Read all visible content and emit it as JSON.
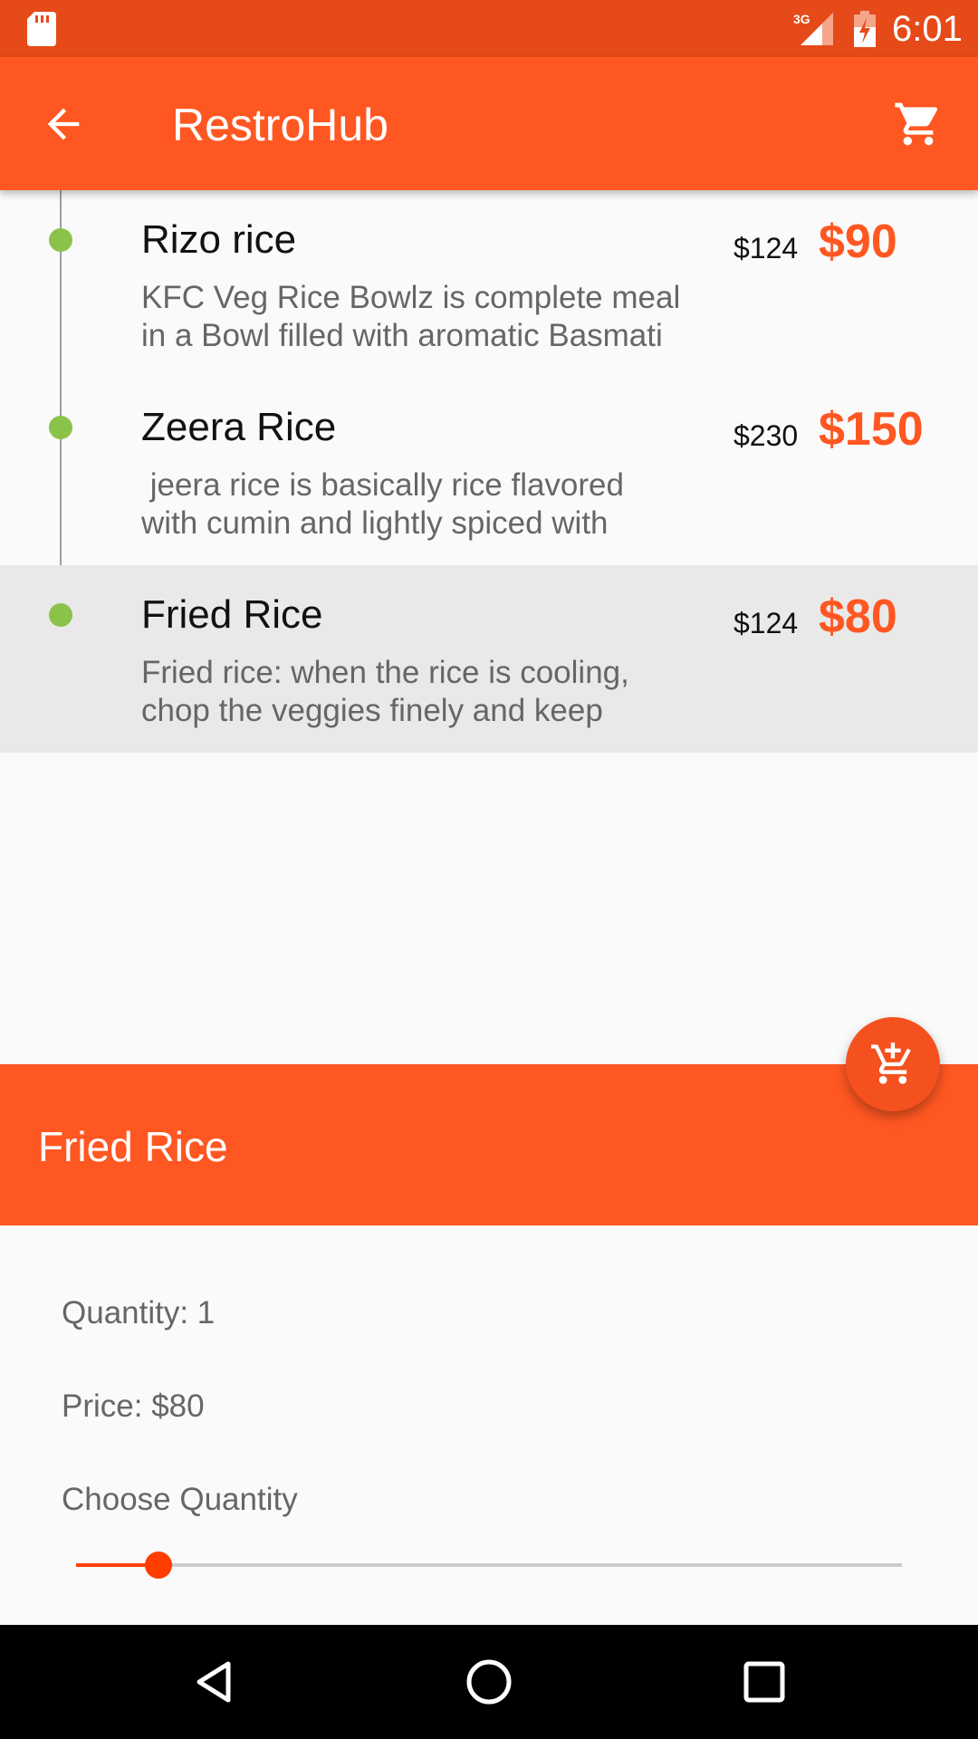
{
  "status_bar": {
    "network": "3G",
    "time": "6:01"
  },
  "app_bar": {
    "title": "RestroHub",
    "back_icon": "arrow-back-icon",
    "cart_icon": "shopping-cart-icon"
  },
  "menu": [
    {
      "name": "Rizo rice",
      "desc": "KFC Veg Rice Bowlz is complete meal\nin a Bowl filled with aromatic Basmati",
      "old_price": "$124",
      "price": "$90",
      "selected": false
    },
    {
      "name": "Zeera Rice",
      "desc": " jeera rice is basically rice flavored\nwith cumin and lightly spiced with",
      "old_price": "$230",
      "price": "$150",
      "selected": false
    },
    {
      "name": "Fried Rice",
      "desc": "Fried rice: when the rice is cooling,\nchop the veggies finely and keep",
      "old_price": "$124",
      "price": "$80",
      "selected": true
    }
  ],
  "fab": {
    "icon": "add-to-cart-icon"
  },
  "detail": {
    "title": "Fried Rice",
    "quantity": "Quantity: 1",
    "price": "Price: $80",
    "choose_label": "Choose Quantity",
    "slider_fraction": 0.1
  },
  "colors": {
    "primary": "#ff5722",
    "primary_dark": "#e64a19",
    "timeline_dot": "#8bc34a"
  },
  "nav": {
    "back_icon": "nav-back-icon",
    "home_icon": "nav-home-icon",
    "recents_icon": "nav-recents-icon"
  }
}
